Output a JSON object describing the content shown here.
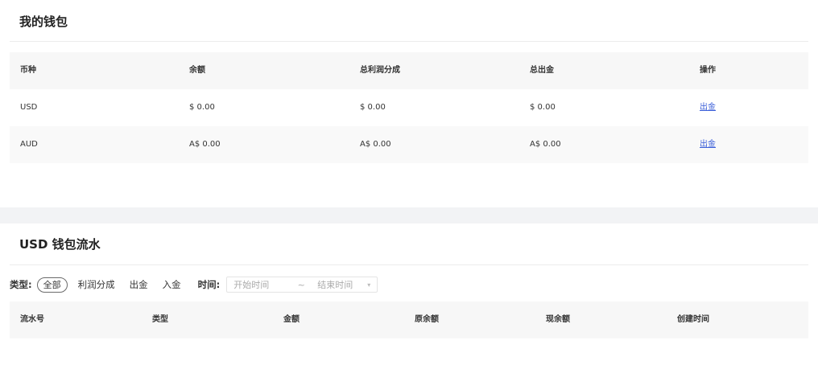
{
  "wallet": {
    "title": "我的钱包",
    "columns": [
      "币种",
      "余额",
      "总利润分成",
      "总出金",
      "操作"
    ],
    "rows": [
      {
        "currency": "USD",
        "balance": "$ 0.00",
        "profit_share": "$ 0.00",
        "total_withdrawal": "$ 0.00",
        "action": "出金"
      },
      {
        "currency": "AUD",
        "balance": "A$ 0.00",
        "profit_share": "A$ 0.00",
        "total_withdrawal": "A$ 0.00",
        "action": "出金"
      }
    ]
  },
  "flow": {
    "title": "USD 钱包流水",
    "filters": {
      "type_label": "类型:",
      "type_options": [
        "全部",
        "利润分成",
        "出金",
        "入金"
      ],
      "selected_type": "全部",
      "time_label": "时间:",
      "start_placeholder": "开始时间",
      "separator": "~",
      "end_placeholder": "结束时间"
    },
    "columns": [
      "流水号",
      "类型",
      "金额",
      "原余额",
      "现余额",
      "创建时间"
    ]
  }
}
